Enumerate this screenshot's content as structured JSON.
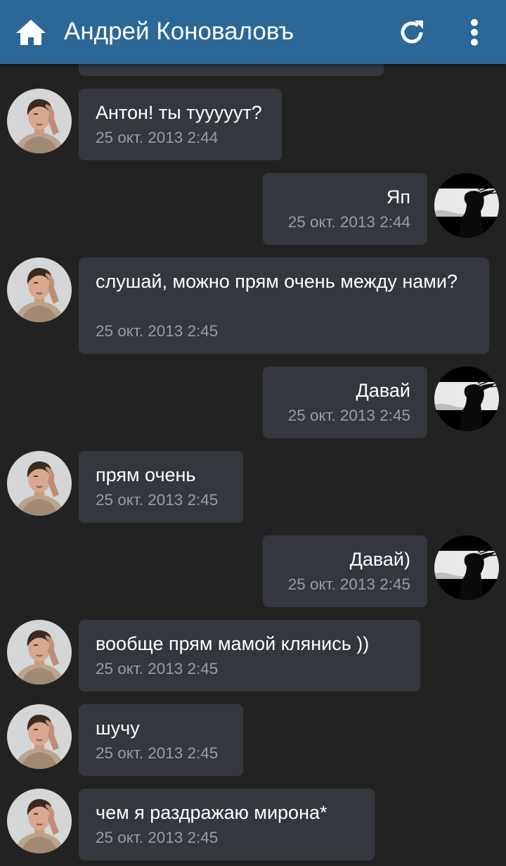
{
  "header": {
    "title": "Андрей Коноваловъ",
    "background": "#2b6797"
  },
  "icons": {
    "home": "home-icon",
    "refresh": "refresh-icon",
    "more": "more-vertical-icon"
  },
  "colors": {
    "background": "#222222",
    "bubble": "#35373f",
    "text": "#ffffff",
    "timestamp": "#9a9ca3"
  },
  "messages": [
    {
      "direction": "in",
      "text": "Антон! ты тууууут?",
      "time": "25 окт. 2013 2:44"
    },
    {
      "direction": "out",
      "text": "Яп",
      "time": "25 окт. 2013 2:44"
    },
    {
      "direction": "in",
      "text": "слушай, можно прям очень между нами?",
      "time": "25 окт. 2013 2:45"
    },
    {
      "direction": "out",
      "text": "Давай",
      "time": "25 окт. 2013 2:45"
    },
    {
      "direction": "in",
      "text": "прям очень",
      "time": "25 окт. 2013 2:45"
    },
    {
      "direction": "out",
      "text": "Давай)",
      "time": "25 окт. 2013 2:45"
    },
    {
      "direction": "in",
      "text": "вообще прям мамой клянись ))",
      "time": "25 окт. 2013 2:45"
    },
    {
      "direction": "in",
      "text": "шучу",
      "time": "25 окт. 2013 2:45"
    },
    {
      "direction": "in",
      "text": "чем я раздражаю мирона*",
      "time": "25 окт. 2013 2:45"
    }
  ]
}
